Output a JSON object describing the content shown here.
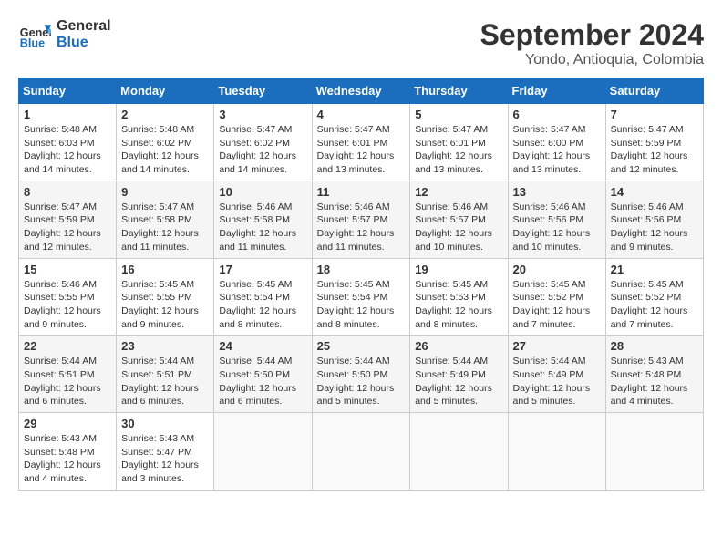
{
  "header": {
    "logo_line1": "General",
    "logo_line2": "Blue",
    "title": "September 2024",
    "subtitle": "Yondo, Antioquia, Colombia"
  },
  "calendar": {
    "days_of_week": [
      "Sunday",
      "Monday",
      "Tuesday",
      "Wednesday",
      "Thursday",
      "Friday",
      "Saturday"
    ],
    "weeks": [
      [
        {
          "num": "",
          "empty": true
        },
        {
          "num": "",
          "empty": true
        },
        {
          "num": "",
          "empty": true
        },
        {
          "num": "",
          "empty": true
        },
        {
          "num": "5",
          "sunrise": "5:47 AM",
          "sunset": "6:01 PM",
          "daylight": "12 hours and 13 minutes."
        },
        {
          "num": "6",
          "sunrise": "5:47 AM",
          "sunset": "6:00 PM",
          "daylight": "12 hours and 13 minutes."
        },
        {
          "num": "7",
          "sunrise": "5:47 AM",
          "sunset": "5:59 PM",
          "daylight": "12 hours and 12 minutes."
        }
      ],
      [
        {
          "num": "1",
          "sunrise": "5:48 AM",
          "sunset": "6:03 PM",
          "daylight": "12 hours and 14 minutes."
        },
        {
          "num": "2",
          "sunrise": "5:48 AM",
          "sunset": "6:02 PM",
          "daylight": "12 hours and 14 minutes."
        },
        {
          "num": "3",
          "sunrise": "5:47 AM",
          "sunset": "6:02 PM",
          "daylight": "12 hours and 14 minutes."
        },
        {
          "num": "4",
          "sunrise": "5:47 AM",
          "sunset": "6:01 PM",
          "daylight": "12 hours and 13 minutes."
        },
        {
          "num": "5",
          "sunrise": "5:47 AM",
          "sunset": "6:01 PM",
          "daylight": "12 hours and 13 minutes."
        },
        {
          "num": "6",
          "sunrise": "5:47 AM",
          "sunset": "6:00 PM",
          "daylight": "12 hours and 13 minutes."
        },
        {
          "num": "7",
          "sunrise": "5:47 AM",
          "sunset": "5:59 PM",
          "daylight": "12 hours and 12 minutes."
        }
      ],
      [
        {
          "num": "8",
          "sunrise": "5:47 AM",
          "sunset": "5:59 PM",
          "daylight": "12 hours and 12 minutes."
        },
        {
          "num": "9",
          "sunrise": "5:47 AM",
          "sunset": "5:58 PM",
          "daylight": "12 hours and 11 minutes."
        },
        {
          "num": "10",
          "sunrise": "5:46 AM",
          "sunset": "5:58 PM",
          "daylight": "12 hours and 11 minutes."
        },
        {
          "num": "11",
          "sunrise": "5:46 AM",
          "sunset": "5:57 PM",
          "daylight": "12 hours and 11 minutes."
        },
        {
          "num": "12",
          "sunrise": "5:46 AM",
          "sunset": "5:57 PM",
          "daylight": "12 hours and 10 minutes."
        },
        {
          "num": "13",
          "sunrise": "5:46 AM",
          "sunset": "5:56 PM",
          "daylight": "12 hours and 10 minutes."
        },
        {
          "num": "14",
          "sunrise": "5:46 AM",
          "sunset": "5:56 PM",
          "daylight": "12 hours and 9 minutes."
        }
      ],
      [
        {
          "num": "15",
          "sunrise": "5:46 AM",
          "sunset": "5:55 PM",
          "daylight": "12 hours and 9 minutes."
        },
        {
          "num": "16",
          "sunrise": "5:45 AM",
          "sunset": "5:55 PM",
          "daylight": "12 hours and 9 minutes."
        },
        {
          "num": "17",
          "sunrise": "5:45 AM",
          "sunset": "5:54 PM",
          "daylight": "12 hours and 8 minutes."
        },
        {
          "num": "18",
          "sunrise": "5:45 AM",
          "sunset": "5:54 PM",
          "daylight": "12 hours and 8 minutes."
        },
        {
          "num": "19",
          "sunrise": "5:45 AM",
          "sunset": "5:53 PM",
          "daylight": "12 hours and 8 minutes."
        },
        {
          "num": "20",
          "sunrise": "5:45 AM",
          "sunset": "5:52 PM",
          "daylight": "12 hours and 7 minutes."
        },
        {
          "num": "21",
          "sunrise": "5:45 AM",
          "sunset": "5:52 PM",
          "daylight": "12 hours and 7 minutes."
        }
      ],
      [
        {
          "num": "22",
          "sunrise": "5:44 AM",
          "sunset": "5:51 PM",
          "daylight": "12 hours and 6 minutes."
        },
        {
          "num": "23",
          "sunrise": "5:44 AM",
          "sunset": "5:51 PM",
          "daylight": "12 hours and 6 minutes."
        },
        {
          "num": "24",
          "sunrise": "5:44 AM",
          "sunset": "5:50 PM",
          "daylight": "12 hours and 6 minutes."
        },
        {
          "num": "25",
          "sunrise": "5:44 AM",
          "sunset": "5:50 PM",
          "daylight": "12 hours and 5 minutes."
        },
        {
          "num": "26",
          "sunrise": "5:44 AM",
          "sunset": "5:49 PM",
          "daylight": "12 hours and 5 minutes."
        },
        {
          "num": "27",
          "sunrise": "5:44 AM",
          "sunset": "5:49 PM",
          "daylight": "12 hours and 5 minutes."
        },
        {
          "num": "28",
          "sunrise": "5:43 AM",
          "sunset": "5:48 PM",
          "daylight": "12 hours and 4 minutes."
        }
      ],
      [
        {
          "num": "29",
          "sunrise": "5:43 AM",
          "sunset": "5:48 PM",
          "daylight": "12 hours and 4 minutes."
        },
        {
          "num": "30",
          "sunrise": "5:43 AM",
          "sunset": "5:47 PM",
          "daylight": "12 hours and 3 minutes."
        },
        {
          "num": "",
          "empty": true
        },
        {
          "num": "",
          "empty": true
        },
        {
          "num": "",
          "empty": true
        },
        {
          "num": "",
          "empty": true
        },
        {
          "num": "",
          "empty": true
        }
      ]
    ]
  }
}
